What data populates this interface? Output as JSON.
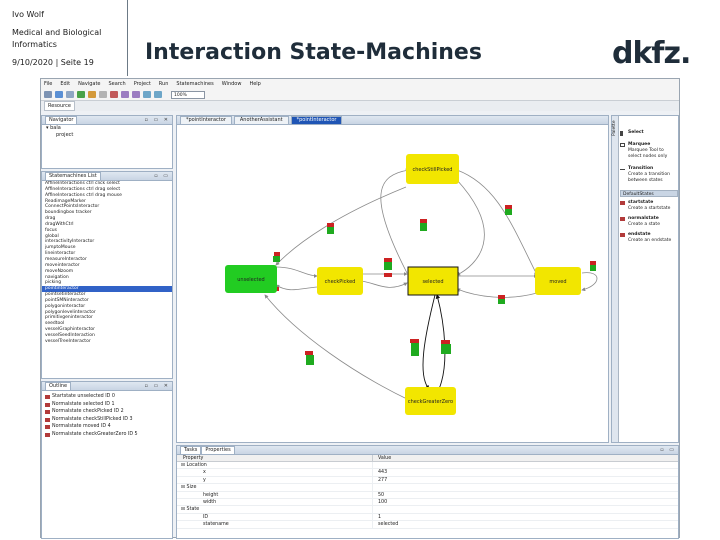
{
  "slide": {
    "author": "Ivo Wolf",
    "institute": "Medical and Biological Informatics",
    "date_line": "9/10/2020 | Seite 19",
    "title": "Interaction State-Machines",
    "logo_text": "dkfz."
  },
  "menubar": [
    "File",
    "Edit",
    "Navigate",
    "Search",
    "Project",
    "Run",
    "Statemachines",
    "Window",
    "Help"
  ],
  "toolbar": {
    "zoom": "100%"
  },
  "perspective": {
    "tab": "Resource"
  },
  "navigator": {
    "tab": "Navigator",
    "items": [
      "bala",
      "project"
    ]
  },
  "sm_list": {
    "tab": "Statemachines List",
    "items": [
      "AffineInteractions ctrl click select",
      "AffineInteractions ctrl drag select",
      "AffineInteractions ctrl drag mouse",
      "ReadimageMarker",
      "ConnectPointsInteractor",
      "boundingbox tracker",
      "drag",
      "dragWithCtrl",
      "focus",
      "global",
      "interactivityInteractor",
      "jumptoMouse",
      "lineinteractor",
      "measureInteractor",
      "moveinteractor",
      "moveNzoom",
      "navigation",
      "picking",
      "pointinteractor",
      "pointsetinteractor",
      "pointSMNinteractor",
      "polygoninteractor",
      "polygonlevelinteractor",
      "primitivgeninteractor",
      "seedtool",
      "vesselGraphinteractor",
      "vesselSeedInteraction",
      "vesselTreeInteractor"
    ],
    "selected_index": 18
  },
  "outline": {
    "tab": "Outline",
    "items": [
      "Startstate unselected ID 0",
      "Normalstate selected ID 1",
      "Normalstate checkPicked ID 2",
      "Normalstate checkStillPicked ID 3",
      "Normalstate moved ID 4",
      "Normalstate checkGreaterZero ID 5"
    ]
  },
  "editor": {
    "tabs": [
      "*pointInteractor",
      "AnotherAssistant",
      "*pointInteractor"
    ],
    "active_tab": 2,
    "states": [
      {
        "name": "checkStillPicked",
        "start": false
      },
      {
        "name": "unselected",
        "start": true
      },
      {
        "name": "checkPicked",
        "start": false
      },
      {
        "name": "selected",
        "start": false
      },
      {
        "name": "moved",
        "start": false
      },
      {
        "name": "checkGreaterZero",
        "start": false
      }
    ],
    "colors": {
      "normal_state": "#f2e600",
      "start_state": "#22cc22",
      "event_label": "#cc2222",
      "action_label": "#1faa1f",
      "edge": "#8a8a8a",
      "edge_active": "#111111"
    }
  },
  "palette": {
    "strip": "Palette",
    "tools": [
      {
        "title": "Select",
        "desc": "Select"
      },
      {
        "title": "Marquee",
        "desc": "Marquee Tool to select nodes only"
      },
      {
        "title": "Transition",
        "desc": "Create a transition between states"
      }
    ],
    "section": "DefaultStates",
    "states": [
      {
        "title": "startstate",
        "desc": "Create a startstate"
      },
      {
        "title": "normalstate",
        "desc": "Create a state"
      },
      {
        "title": "endstate",
        "desc": "Create an endstate"
      }
    ]
  },
  "properties": {
    "tabs": [
      "Tasks",
      "Properties"
    ],
    "columns": [
      "Property",
      "Value"
    ],
    "rows": [
      {
        "p": "Location",
        "v": "",
        "level": 0
      },
      {
        "p": "x",
        "v": "443",
        "level": 1
      },
      {
        "p": "y",
        "v": "277",
        "level": 1
      },
      {
        "p": "Size",
        "v": "",
        "level": 0
      },
      {
        "p": "height",
        "v": "50",
        "level": 1
      },
      {
        "p": "width",
        "v": "100",
        "level": 1
      },
      {
        "p": "State",
        "v": "",
        "level": 0
      },
      {
        "p": "ID",
        "v": "1",
        "level": 1
      },
      {
        "p": "statename",
        "v": "selected",
        "level": 1
      }
    ]
  }
}
